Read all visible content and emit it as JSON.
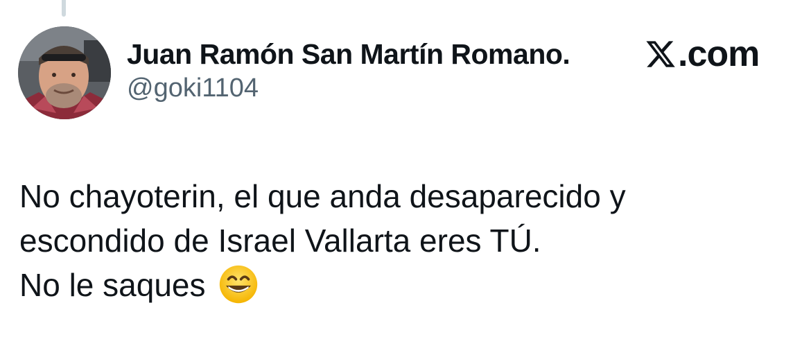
{
  "author": {
    "display_name": "Juan Ramón San Martín Romano.",
    "handle": "@goki1104"
  },
  "brand": {
    "domain": ".com",
    "logo_icon": "x-logo-icon"
  },
  "tweet": {
    "lines": [
      "No chayoterin, el que anda desaparecido y",
      "escondido de Israel Vallarta eres TÚ.",
      "No le saques"
    ],
    "emoji": "grinning-face-with-smiling-eyes"
  },
  "colors": {
    "text": "#0f1419",
    "secondary_text": "#536471",
    "thread_line": "#cfd9de",
    "background": "#ffffff"
  }
}
